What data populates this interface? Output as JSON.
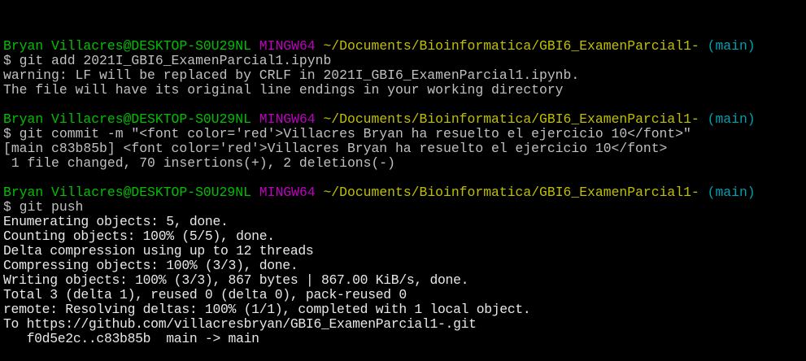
{
  "prompt": {
    "user_host": "Bryan Villacres@DESKTOP-S0U29NL",
    "system": "MINGW64",
    "path": "~/Documents/Bioinformatica/GBI6_ExamenParcial1-",
    "branch": "(main)"
  },
  "blocks": [
    {
      "command": "$ git add 2021I_GBI6_ExamenParcial1.ipynb",
      "output": [
        "warning: LF will be replaced by CRLF in 2021I_GBI6_ExamenParcial1.ipynb.",
        "The file will have its original line endings in your working directory"
      ]
    },
    {
      "command": "$ git commit -m \"<font color='red'>Villacres Bryan ha resuelto el ejercicio 10</font>\"",
      "output": [
        "[main c83b85b] <font color='red'>Villacres Bryan ha resuelto el ejercicio 10</font>",
        " 1 file changed, 70 insertions(+), 2 deletions(-)"
      ]
    },
    {
      "command": "$ git push",
      "output": [
        "Enumerating objects: 5, done.",
        "Counting objects: 100% (5/5), done.",
        "Delta compression using up to 12 threads",
        "Compressing objects: 100% (3/3), done.",
        "Writing objects: 100% (3/3), 867 bytes | 867.00 KiB/s, done.",
        "Total 3 (delta 1), reused 0 (delta 0), pack-reused 0",
        "remote: Resolving deltas: 100% (1/1), completed with 1 local object.",
        "To https://github.com/villacresbryan/GBI6_ExamenParcial1-.git",
        "   f0d5e2c..c83b85b  main -> main"
      ]
    }
  ],
  "colors": {
    "user": "#00c000",
    "system": "#c000c0",
    "path": "#c0c000",
    "branch": "#00a0b0",
    "text": "#c0c0c0",
    "background": "#000000"
  }
}
